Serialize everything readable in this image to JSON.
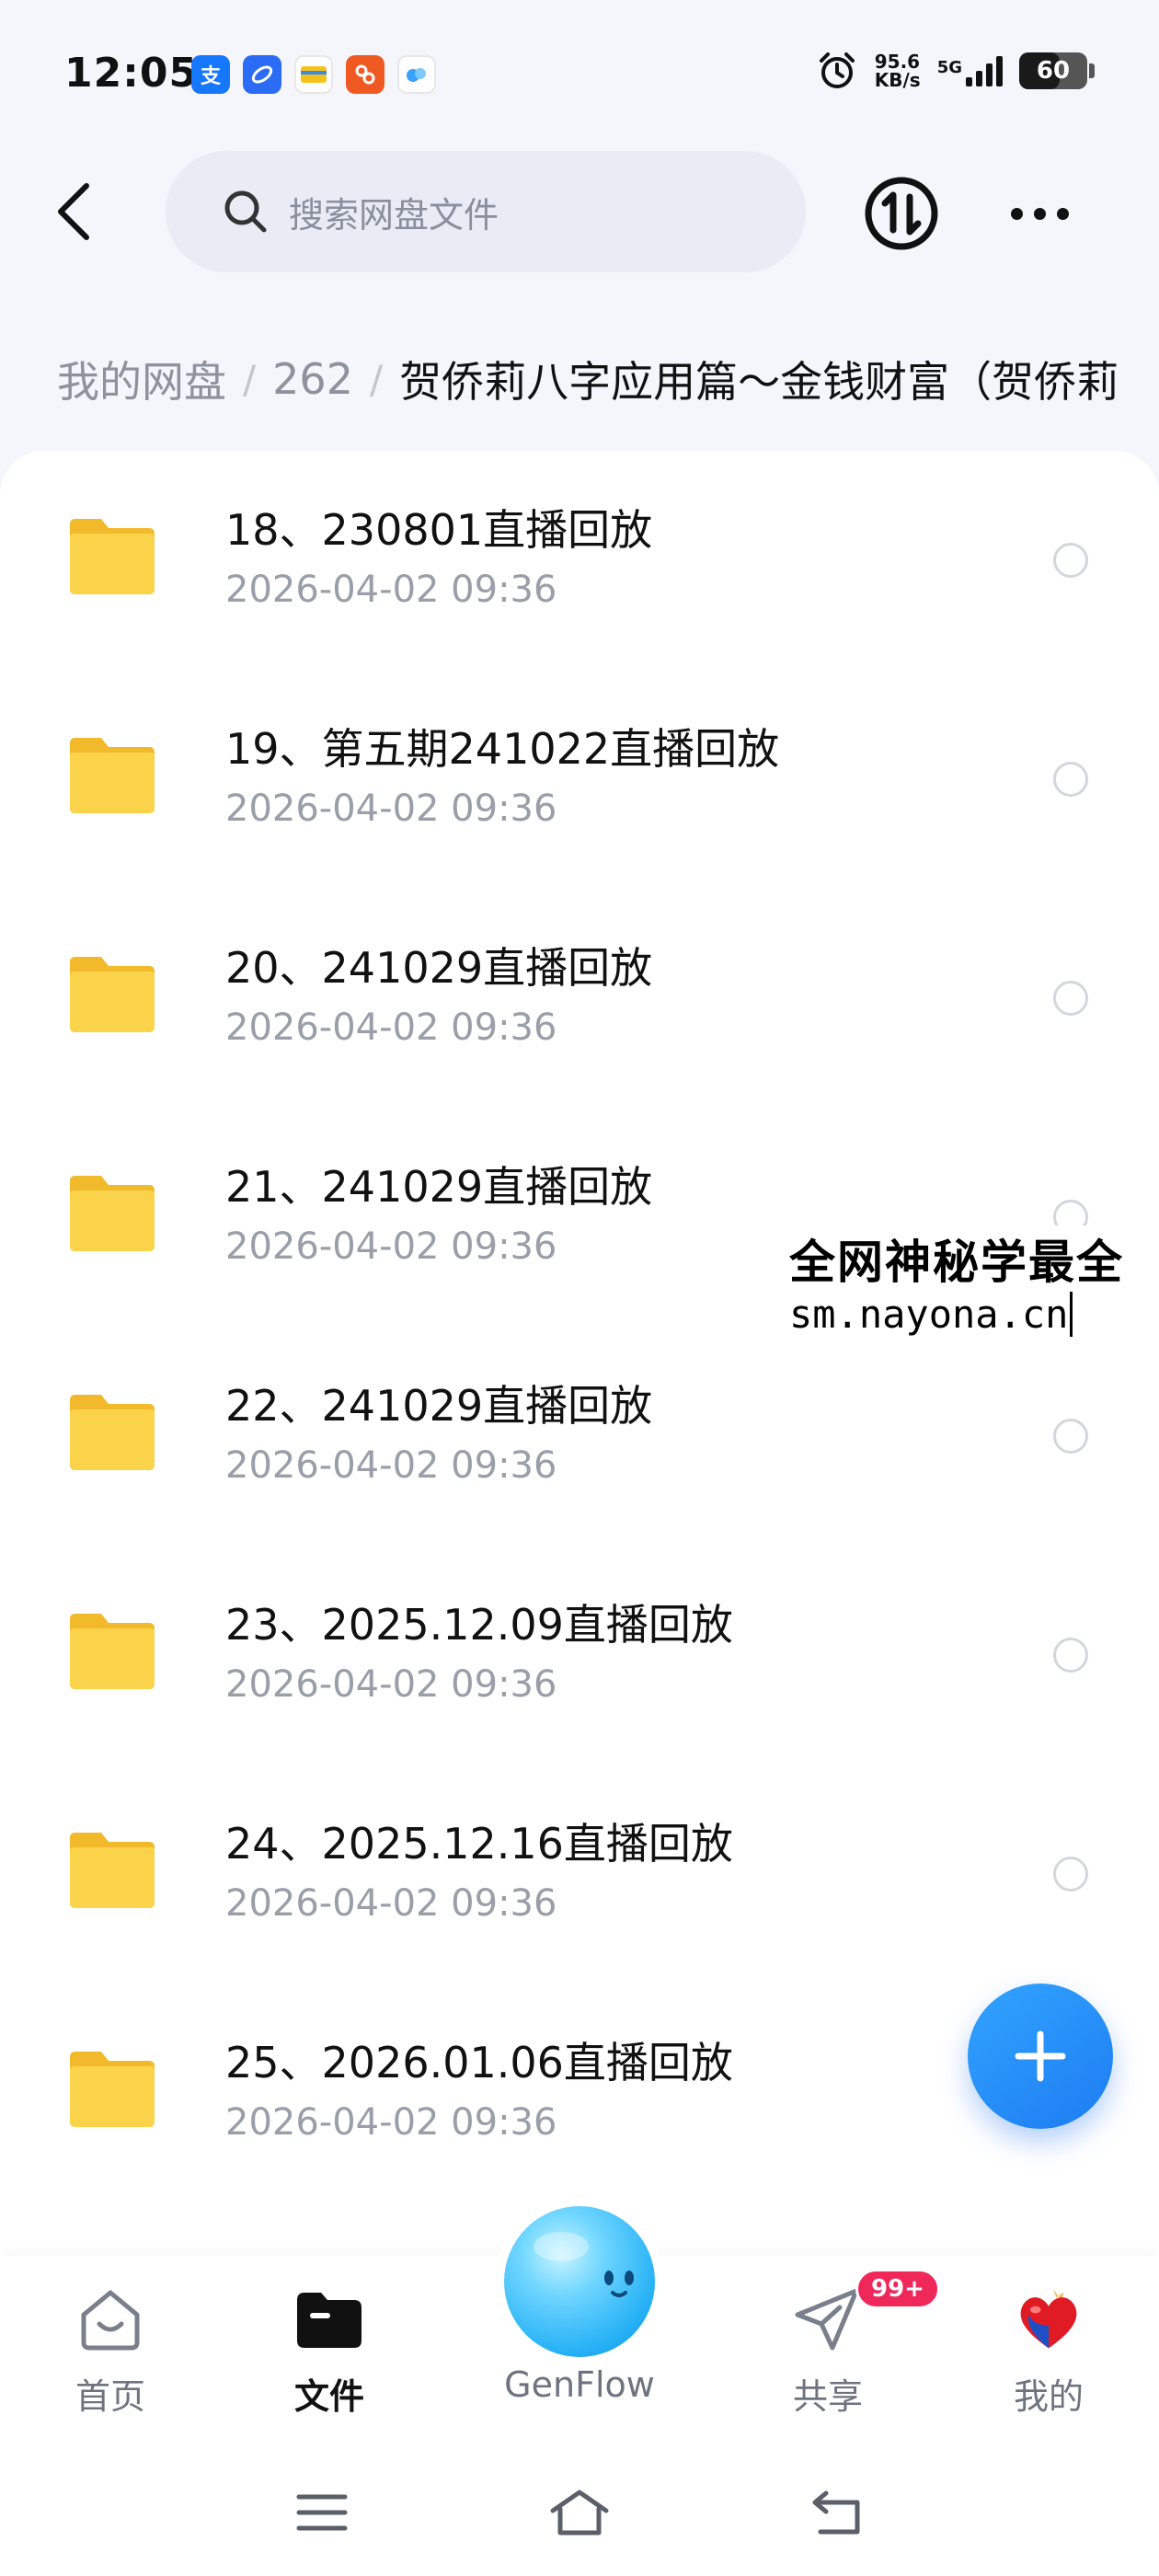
{
  "status_bar": {
    "time": "12:05",
    "net_speed_value": "95.6",
    "net_speed_unit": "KB/s",
    "network": "5G",
    "battery": "60",
    "apps": [
      {
        "name": "alipay-app-icon",
        "glyph": "支",
        "color": "#1677ff"
      },
      {
        "name": "blue-app-icon",
        "glyph": "",
        "color": "#2a6cf6"
      },
      {
        "name": "card-app-icon",
        "glyph": "",
        "color": "#f5c21b"
      },
      {
        "name": "orange-app-icon",
        "glyph": "",
        "color": "#f05a22"
      },
      {
        "name": "genflow-app-icon",
        "glyph": "",
        "color": "#3aa0ff"
      }
    ]
  },
  "header": {
    "search_placeholder": "搜索网盘文件"
  },
  "breadcrumb": {
    "items": [
      "我的网盘",
      "262"
    ],
    "current": "贺侨莉八字应用篇～金钱财富（贺侨莉"
  },
  "files": [
    {
      "name": "18、230801直播回放",
      "date": "2026-04-02  09:36"
    },
    {
      "name": "19、第五期241022直播回放",
      "date": "2026-04-02  09:36"
    },
    {
      "name": "20、241029直播回放",
      "date": "2026-04-02  09:36"
    },
    {
      "name": "21、241029直播回放",
      "date": "2026-04-02  09:36"
    },
    {
      "name": "22、241029直播回放",
      "date": "2026-04-02  09:36"
    },
    {
      "name": "23、2025.12.09直播回放",
      "date": "2026-04-02  09:36"
    },
    {
      "name": "24、2025.12.16直播回放",
      "date": "2026-04-02  09:36"
    },
    {
      "name": "25、2026.01.06直播回放",
      "date": "2026-04-02  09:36"
    }
  ],
  "watermark": {
    "line1": "全网神秘学最全",
    "line2": "sm.nayona.cn"
  },
  "bottom_nav": {
    "home": "首页",
    "files": "文件",
    "genflow": "GenFlow",
    "share": "共享",
    "share_badge": "99+",
    "me": "我的"
  },
  "colors": {
    "accent": "#1d7cf2",
    "folder": "#f9cc3c",
    "badge": "#f0285a"
  }
}
